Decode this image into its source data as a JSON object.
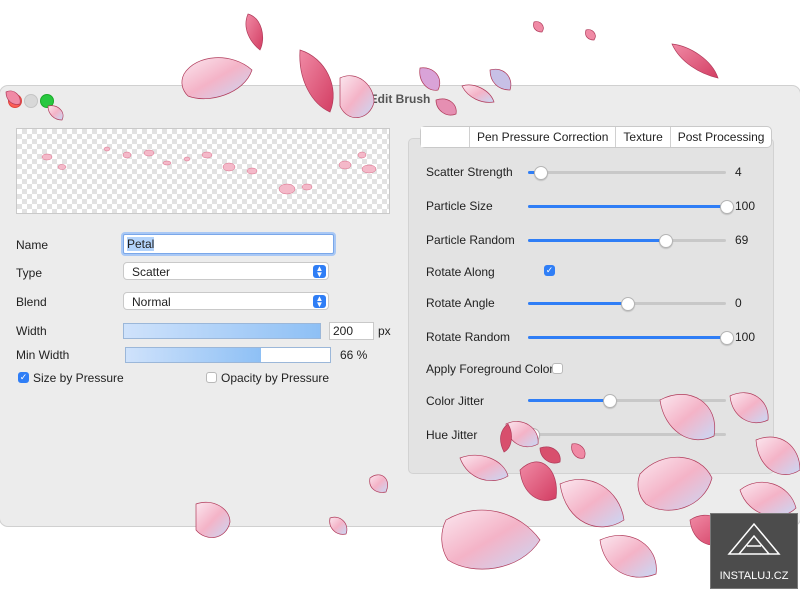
{
  "window": {
    "title": "Edit Brush"
  },
  "form": {
    "name_label": "Name",
    "name_value": "Petal",
    "type_label": "Type",
    "type_value": "Scatter",
    "blend_label": "Blend",
    "blend_value": "Normal",
    "width_label": "Width",
    "width_value": "200",
    "width_unit": "px",
    "width_fraction": 1.0,
    "minwidth_label": "Min Width",
    "minwidth_value": "66 %",
    "minwidth_fraction": 0.66,
    "size_by_pressure_label": "Size by Pressure",
    "size_by_pressure_checked": true,
    "opacity_by_pressure_label": "Opacity by Pressure",
    "opacity_by_pressure_checked": false
  },
  "tabs": [
    {
      "label": ""
    },
    {
      "label": "Pen Pressure Correction"
    },
    {
      "label": "Texture"
    },
    {
      "label": "Post Processing"
    }
  ],
  "settings": [
    {
      "label": "Scatter Strength",
      "value": "4",
      "fraction": 0.06
    },
    {
      "label": "Particle Size",
      "value": "100",
      "fraction": 1.0
    },
    {
      "label": "Particle Random",
      "value": "69",
      "fraction": 0.69
    },
    {
      "label": "Rotate Along",
      "checked": true
    },
    {
      "label": "Rotate Angle",
      "value": "0",
      "fraction": 0.5
    },
    {
      "label": "Rotate Random",
      "value": "100",
      "fraction": 1.0
    },
    {
      "label": "Apply Foreground Color",
      "checked": false
    },
    {
      "label": "Color Jitter",
      "value": "",
      "fraction": 0.41
    },
    {
      "label": "Hue Jitter",
      "value": "",
      "fraction": 0.02
    }
  ],
  "watermark": {
    "text": "INSTALUJ.CZ"
  },
  "colors": {
    "accent": "#2f7ef6",
    "petal": "#f2a7bd",
    "petal_dark": "#d84f6d"
  }
}
